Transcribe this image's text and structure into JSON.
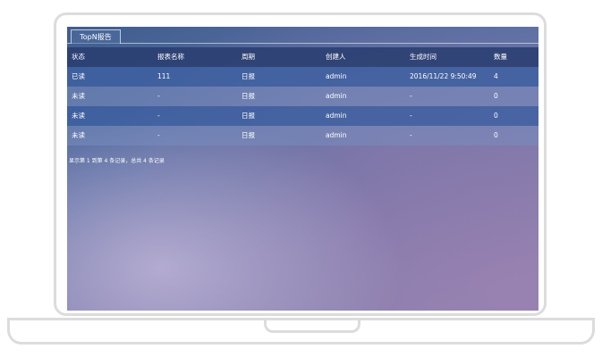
{
  "tab": {
    "label": "TopN报告"
  },
  "table": {
    "headers": [
      "状态",
      "报表名称",
      "周期",
      "创建人",
      "生成时间",
      "数量"
    ],
    "rows": [
      [
        "已读",
        "111",
        "日报",
        "admin",
        "2016/11/22 9:50:49",
        "4"
      ],
      [
        "未读",
        "-",
        "日报",
        "admin",
        "-",
        "0"
      ],
      [
        "未读",
        "-",
        "日报",
        "admin",
        "-",
        "0"
      ],
      [
        "未读",
        "-",
        "日报",
        "admin",
        "-",
        "0"
      ]
    ]
  },
  "footer": {
    "text": "显示第 1 到第 4 条记录，总共 4 条记录"
  },
  "colors": {
    "frame": "#dcdcdc",
    "header_row": "#283c6e",
    "row_dark": "#3c5fa0",
    "row_light": "#788cbe"
  }
}
